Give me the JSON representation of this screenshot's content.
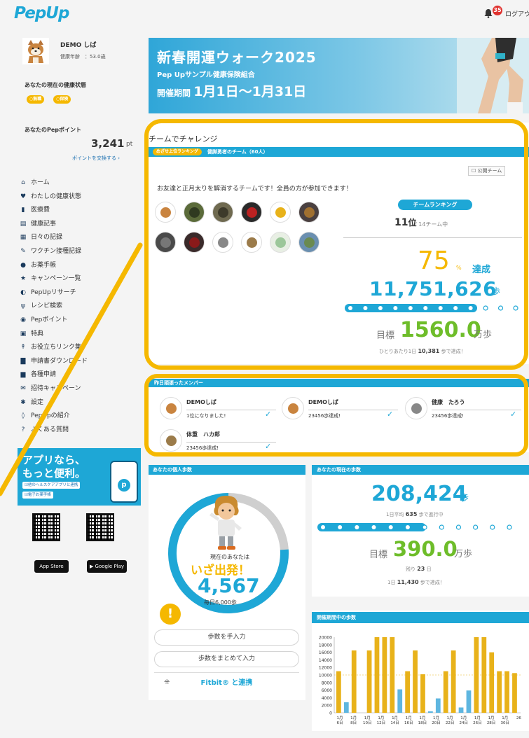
{
  "header": {
    "logo": "PepUp",
    "notifications": "35",
    "logout": "ログアウ"
  },
  "user": {
    "name": "DEMO しば",
    "age_label": "健康年齢　：53.0歳"
  },
  "health": {
    "label": "あなたの現在の健康状態",
    "pills": [
      "○無職",
      "○保険"
    ]
  },
  "points": {
    "label": "あなたのPepポイント",
    "value": "3,241",
    "unit": "pt",
    "exchange": "ポイントを交換する ›"
  },
  "nav": [
    {
      "icon": "home-icon",
      "glyph": "⌂",
      "label": "ホーム"
    },
    {
      "icon": "heart-icon",
      "glyph": "♥",
      "label": "わたしの健康状態"
    },
    {
      "icon": "bar-chart-icon",
      "glyph": "▮",
      "label": "医療費"
    },
    {
      "icon": "article-icon",
      "glyph": "▤",
      "label": "健康記事"
    },
    {
      "icon": "calendar-icon",
      "glyph": "▦",
      "label": "日々の記録"
    },
    {
      "icon": "syringe-icon",
      "glyph": "✎",
      "label": "ワクチン接種記録"
    },
    {
      "icon": "pill-icon",
      "glyph": "●",
      "label": "お薬手帳"
    },
    {
      "icon": "star-icon",
      "glyph": "★",
      "label": "キャンペーン一覧"
    },
    {
      "icon": "research-icon",
      "glyph": "◐",
      "label": "PepUpリサーチ"
    },
    {
      "icon": "cutlery-icon",
      "glyph": "ψ",
      "label": "レシピ検索"
    },
    {
      "icon": "coin-icon",
      "glyph": "◉",
      "label": "Pepポイント"
    },
    {
      "icon": "gift-icon",
      "glyph": "▣",
      "label": "特典"
    },
    {
      "icon": "pin-icon",
      "glyph": "↟",
      "label": "お役立ちリンク集"
    },
    {
      "icon": "document-icon",
      "glyph": "▇",
      "label": "申請書ダウンロード"
    },
    {
      "icon": "file-icon",
      "glyph": "▆",
      "label": "各種申請"
    },
    {
      "icon": "invite-icon",
      "glyph": "✉",
      "label": "招待キャンペーン"
    },
    {
      "icon": "gear-icon",
      "glyph": "✱",
      "label": "設定"
    },
    {
      "icon": "location-icon",
      "glyph": "◊",
      "label": "PepUpの紹介"
    },
    {
      "icon": "help-icon",
      "glyph": "?",
      "label": "よくある質問"
    }
  ],
  "promo": {
    "title1": "アプリなら、",
    "title2": "もっと便利。",
    "tag1": "☑他のヘルスケアアプリと連携",
    "tag2": "☑電子お薬手帳",
    "appstore": "App Store",
    "googleplay": "Google Play"
  },
  "banner": {
    "title": "新春開運ウォーク2025",
    "org": "Pep Upサンプル健康保険組合",
    "period_prefix": "開催期間",
    "period": "1月1日〜1月31日"
  },
  "team": {
    "section_title": "チームでチャレンジ",
    "tag": "めざせ上位ランキング",
    "name": "健脚勇者のチーム（60人）",
    "public_label": "☐ 公開チーム",
    "description": "お友達と正月太りを解消するチームです！全員の方が参加できます！",
    "rank_label": "チームランキング",
    "rank": "11",
    "rank_unit": "位",
    "rank_total": "/ 14チーム中",
    "percent": "75",
    "percent_unit": "%",
    "percent_label": "達成",
    "steps": "11,751,626",
    "steps_unit": "歩",
    "progress": 0.75,
    "goal_label": "目標",
    "goal": "1560.0",
    "goal_unit": "万歩",
    "per_person_prefix": "ひとりあたり1日",
    "per_person": "10,381",
    "per_person_suffix": "歩で達成！"
  },
  "members": {
    "title": "昨日頑張ったメンバー",
    "list": [
      {
        "name": "DEMOしば",
        "message": "1位になりました!"
      },
      {
        "name": "DEMOしば",
        "message": "23456歩達成!"
      },
      {
        "name": "健康　たろう",
        "message": "23456歩達成!"
      },
      {
        "name": "体重　ハカ郎",
        "message": "23456歩達成!"
      }
    ]
  },
  "personal": {
    "title": "あなたの個人歩数",
    "now_label": "現在のあなたは",
    "status": "いざ出発！",
    "steps": "4,567",
    "daily": "毎日6,000歩",
    "progress": 0.76,
    "button_manual": "歩数を手入力",
    "button_bulk": "歩数をまとめて入力",
    "fitbit": "Fitbit® と連携"
  },
  "current": {
    "title": "あなたの現在の歩数",
    "steps": "208,424",
    "steps_unit": "歩",
    "avg_prefix": "1日平均",
    "avg": "635",
    "avg_suffix": "歩で進行中",
    "progress": 0.55,
    "goal_label": "目標",
    "goal": "390.0",
    "goal_unit": "万歩",
    "remain_prefix": "残り",
    "remain": "23",
    "remain_suffix": "日",
    "needed_prefix": "1日",
    "needed": "11,430",
    "needed_suffix": "歩で達成！"
  },
  "chart_data": {
    "type": "bar",
    "title": "開催期間中の歩数",
    "ylim": [
      0,
      20000
    ],
    "yticks": [
      0,
      2000,
      4000,
      6000,
      8000,
      10000,
      12000,
      14000,
      16000,
      18000,
      20000
    ],
    "target_line": 10000,
    "x_labels": [
      "1月6日",
      "1月8日",
      "1月10日",
      "1月12日",
      "1月14日",
      "1月16日",
      "1月18日",
      "1月20日",
      "1月22日",
      "1月24日",
      "1月26日",
      "1月28日",
      "1月30日",
      "26"
    ],
    "series": [
      {
        "color": "#e8b21a",
        "values": [
          11000,
          0,
          16500,
          0,
          16500,
          20000,
          20000,
          20000,
          0,
          11000,
          16500,
          10200,
          0,
          0,
          11000,
          16500,
          0,
          0,
          20000,
          20000,
          16000,
          11000,
          11000,
          10500
        ]
      },
      {
        "color": "#5eb6e0",
        "values": [
          0,
          2800,
          0,
          0,
          0,
          0,
          0,
          0,
          6200,
          0,
          0,
          0,
          400,
          3800,
          0,
          0,
          1400,
          5900,
          0,
          0,
          0,
          0,
          0,
          0
        ]
      }
    ]
  }
}
